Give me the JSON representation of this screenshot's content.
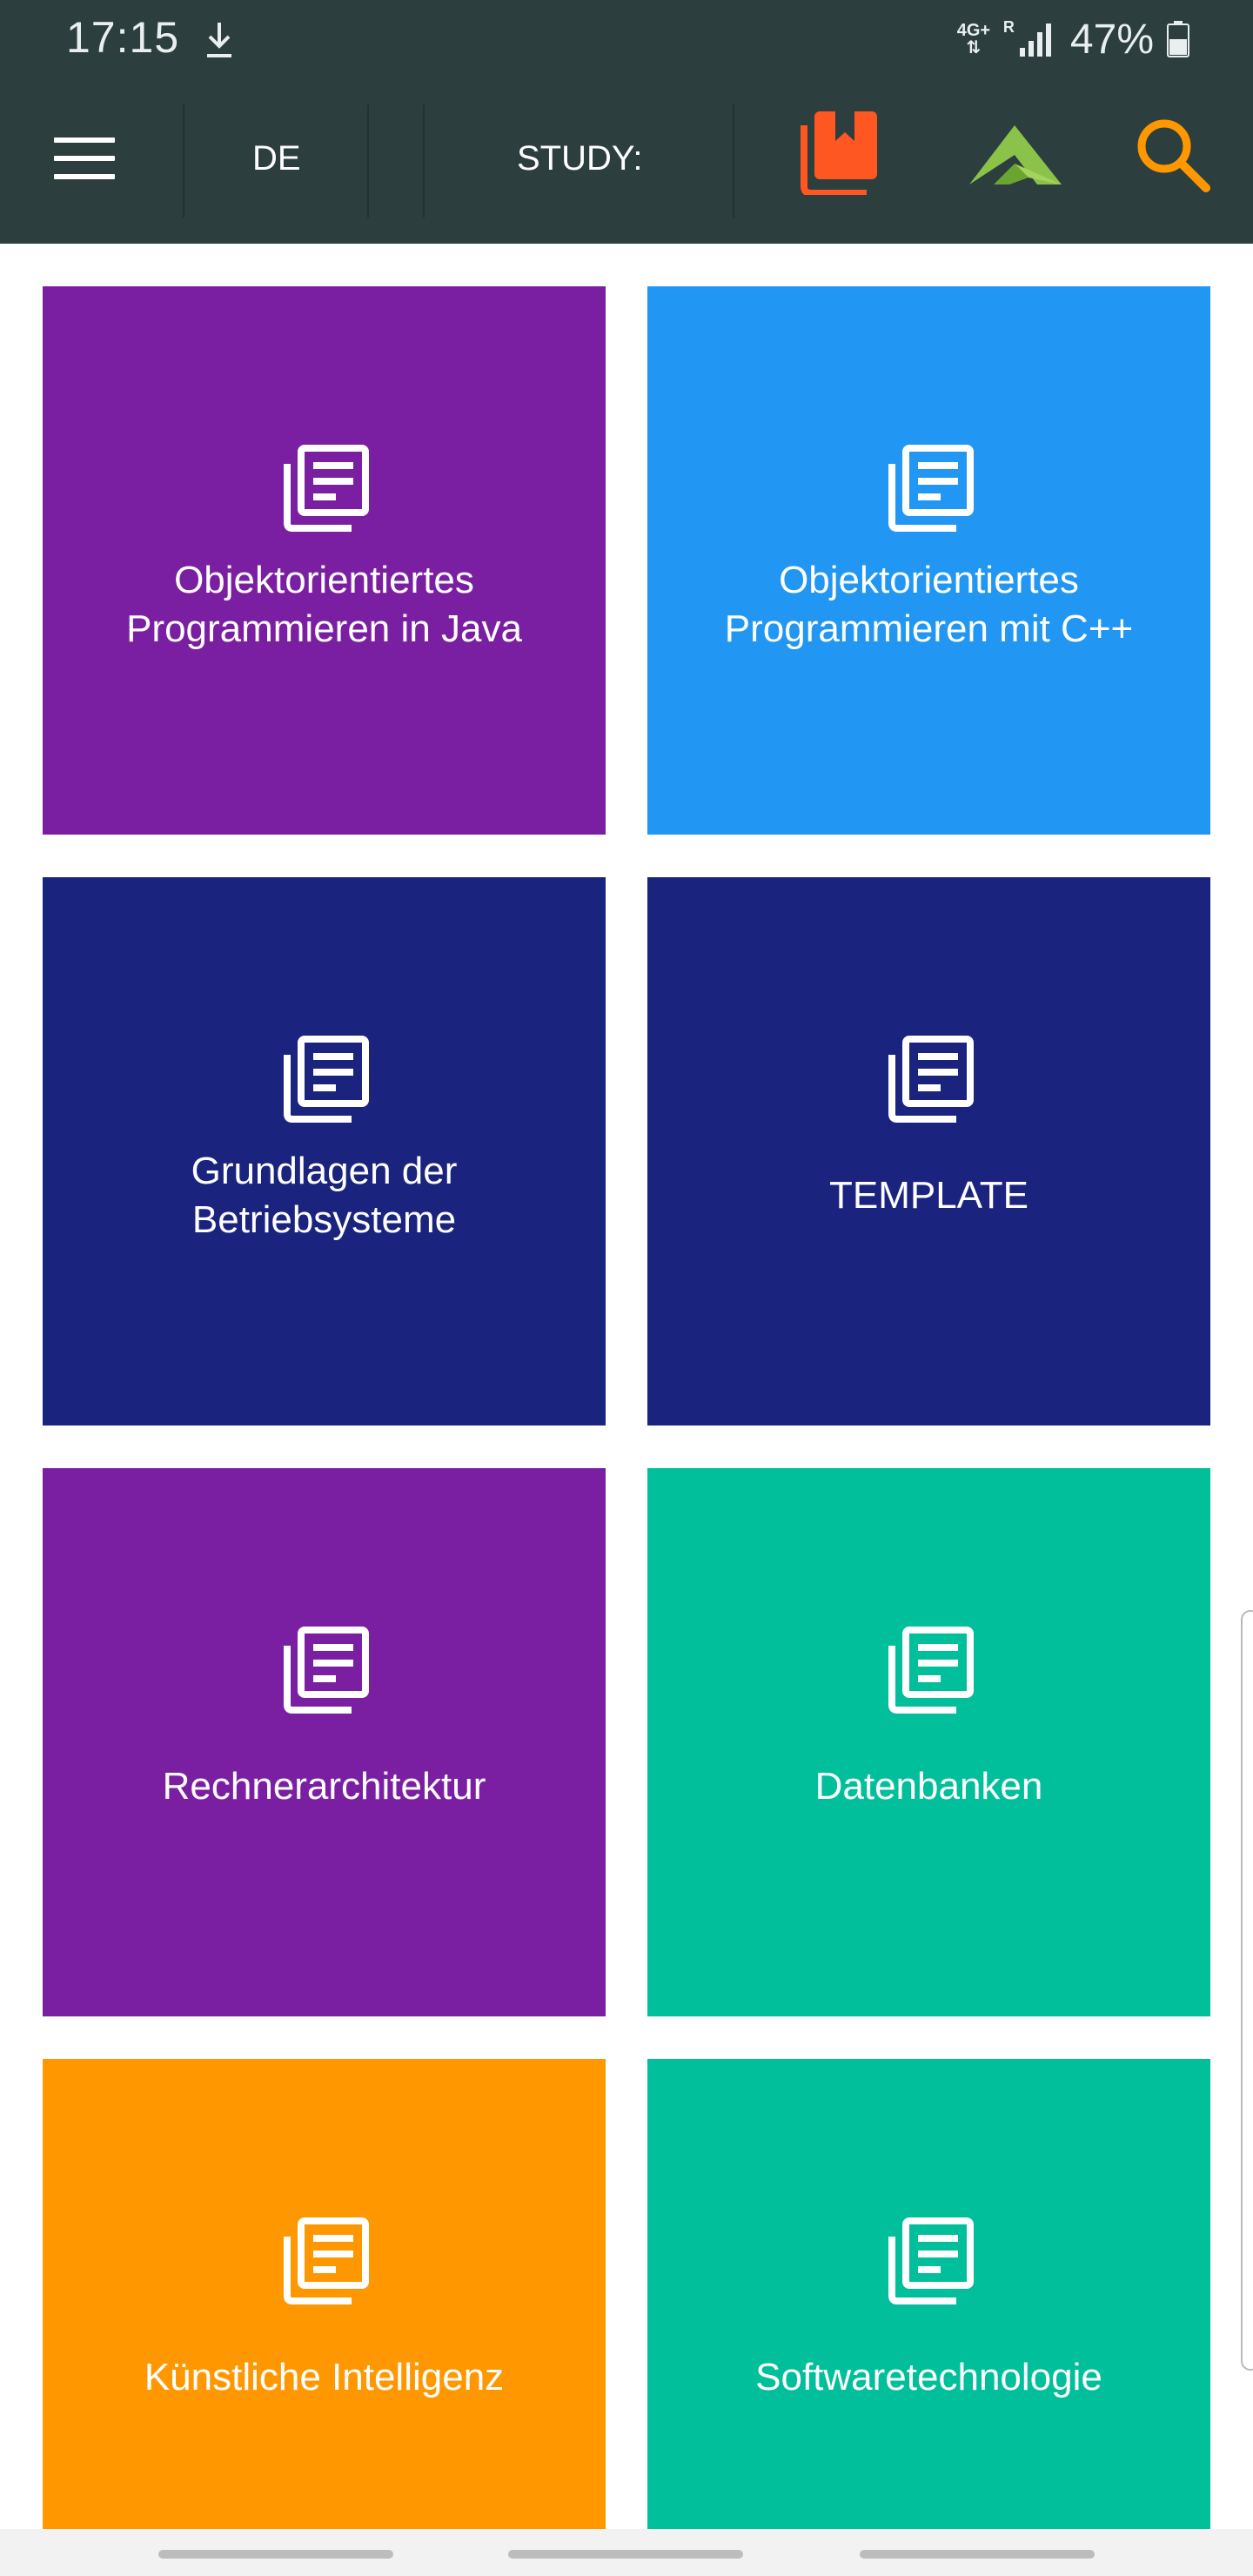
{
  "status_bar": {
    "time": "17:15",
    "network": "4G+",
    "roaming": "R",
    "battery": "47%",
    "icons": [
      "download-icon",
      "signal-icon",
      "battery-icon"
    ]
  },
  "toolbar": {
    "language": "DE",
    "study_label": "STUDY:",
    "icons": [
      "menu-icon",
      "book-icon",
      "app-logo-icon",
      "search-icon"
    ],
    "accent_orange": "#ff5722",
    "logo_green": "#8bc34a",
    "search_color": "#ff9800"
  },
  "tiles": [
    {
      "label": "Objektorientiertes Programmieren in Java",
      "color": "#7b1fa2",
      "icon": "document-list-icon"
    },
    {
      "label": "Objektorientiertes Programmieren mit C++",
      "color": "#2196f3",
      "icon": "document-list-icon"
    },
    {
      "label": "Grundlagen der Betriebsysteme",
      "color": "#1a237e",
      "icon": "document-list-icon"
    },
    {
      "label": "TEMPLATE",
      "color": "#1a237e",
      "icon": "document-list-icon"
    },
    {
      "label": "Rechnerarchitektur",
      "color": "#7b1fa2",
      "icon": "document-list-icon"
    },
    {
      "label": "Datenbanken",
      "color": "#00bf9a",
      "icon": "document-list-icon"
    },
    {
      "label": "Künstliche Intelligenz",
      "color": "#ff9800",
      "icon": "document-list-icon"
    },
    {
      "label": "Softwaretechnologie",
      "color": "#00bf9a",
      "icon": "document-list-icon"
    }
  ]
}
